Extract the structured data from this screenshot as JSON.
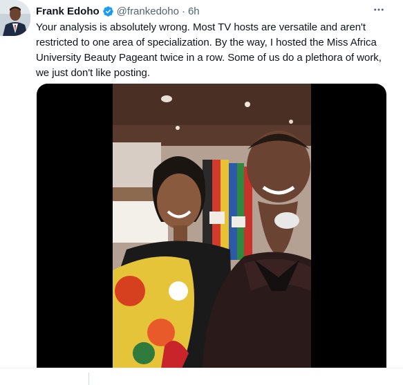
{
  "tweet": {
    "author_name": "Frank Edoho",
    "handle": "@frankedoho",
    "separator": "·",
    "time": "6h",
    "text_lines": [
      "Your analysis is absolutely wrong. Most TV hosts are versatile and aren't",
      "restricted to one area of specialization. By the way, I hosted the Miss Africa",
      "University Beauty Pageant twice in a row. Some of us do a plethora of work,",
      "we just don't like posting."
    ],
    "verified_icon": "verified-badge-icon",
    "more_icon": "more-options-icon"
  },
  "colors": {
    "text": "#0f1419",
    "secondary": "#536471",
    "verified": "#1d9bf0",
    "media_bg": "#000000"
  }
}
